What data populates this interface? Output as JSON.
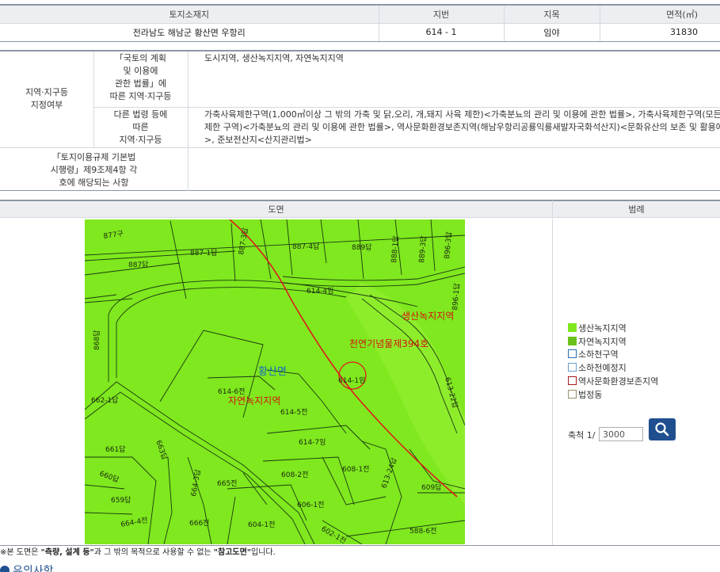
{
  "location_table": {
    "headers": [
      "토지소재지",
      "지번",
      "지목",
      "면적(㎡)"
    ],
    "row": {
      "address": "전라남도 해남군 황산면 우항리",
      "lot_number": "614 - 1",
      "land_category": "임야",
      "area": "31830"
    }
  },
  "zone_table": {
    "main_label": [
      "지역·지구등",
      "지정여부"
    ],
    "national_act_label": [
      "「국토의 계획",
      "및 이용에",
      "관한 법률」에",
      "따른 지역·지구등"
    ],
    "national_act_value": "도시지역, 생산녹지지역, 자연녹지지역",
    "other_act_label": [
      "다른 법령 등에",
      "따른",
      "지역·지구등"
    ],
    "other_act_value_lines": [
      "가축사육제한구역(1,000㎡이상 그 밖의 가축 및 닭,오리, 개,돼지 사육 제한)<가축분뇨의 관리 및 이용에 관한 법률>, 가축사육제한구역(모든 가",
      "제한 구역)<가축분뇨의 관리 및 이용에 관한 법률>, 역사문화환경보존지역(해남우항리공룡익룡새발자국화석산지)<문화유산의 보존 및 활용에",
      ">, 준보전산지<산지관리법>"
    ],
    "enforcement_label": [
      "「토지이용규제 기본법",
      "시행령」제9조제4항 각",
      "호에 해당되는 사항"
    ],
    "enforcement_value": ""
  },
  "map_section": {
    "map_header": "도면",
    "legend_header": "범례",
    "map_labels": {
      "district": "황산면",
      "monument": "천연기념물제394호",
      "green_zone_a": "생산녹지지역",
      "nature_zone": "자연녹지지역",
      "target_lot": "614-1임"
    },
    "parcels": [
      "877구",
      "887답",
      "887-1답",
      "887-3답",
      "887-4답",
      "889답",
      "888-1답",
      "889-3답",
      "896-1답",
      "896-3답",
      "868답",
      "614-4임",
      "614-6전",
      "614-5전",
      "614-7임",
      "662-1답",
      "663답",
      "661답",
      "660답",
      "659답",
      "664-4전",
      "664-3답",
      "665전",
      "666전",
      "604-1전",
      "606-1전",
      "608-2전",
      "608-1전",
      "613-24답",
      "613-22답",
      "609답",
      "588-6전",
      "602-1전"
    ],
    "legend": [
      {
        "label": "생산녹지지역",
        "color": "#7fe81e",
        "style": "fill"
      },
      {
        "label": "자연녹지지역",
        "color": "#6cc21a",
        "style": "fill"
      },
      {
        "label": "소하천구역",
        "color": "#2a6fb5",
        "style": "outline"
      },
      {
        "label": "소하천예정지",
        "color": "#6a9ed0",
        "style": "outline"
      },
      {
        "label": "역사문화환경보존지역",
        "color": "#a31a1a",
        "style": "outline"
      },
      {
        "label": "법정동",
        "color": "#9a8f6a",
        "style": "outline"
      }
    ],
    "scale": {
      "label": "축척 1/",
      "value": "3000"
    },
    "search_icon": "search-icon"
  },
  "note": {
    "prefix": "※본 도면은 ",
    "bold1": "\"측량, 설계 등\"",
    "middle": "과 그 밖의 목적으로 사용할 수 없는 ",
    "bold2": "\"참고도면\"",
    "suffix": "입니다."
  },
  "caution_title": "유의사항"
}
